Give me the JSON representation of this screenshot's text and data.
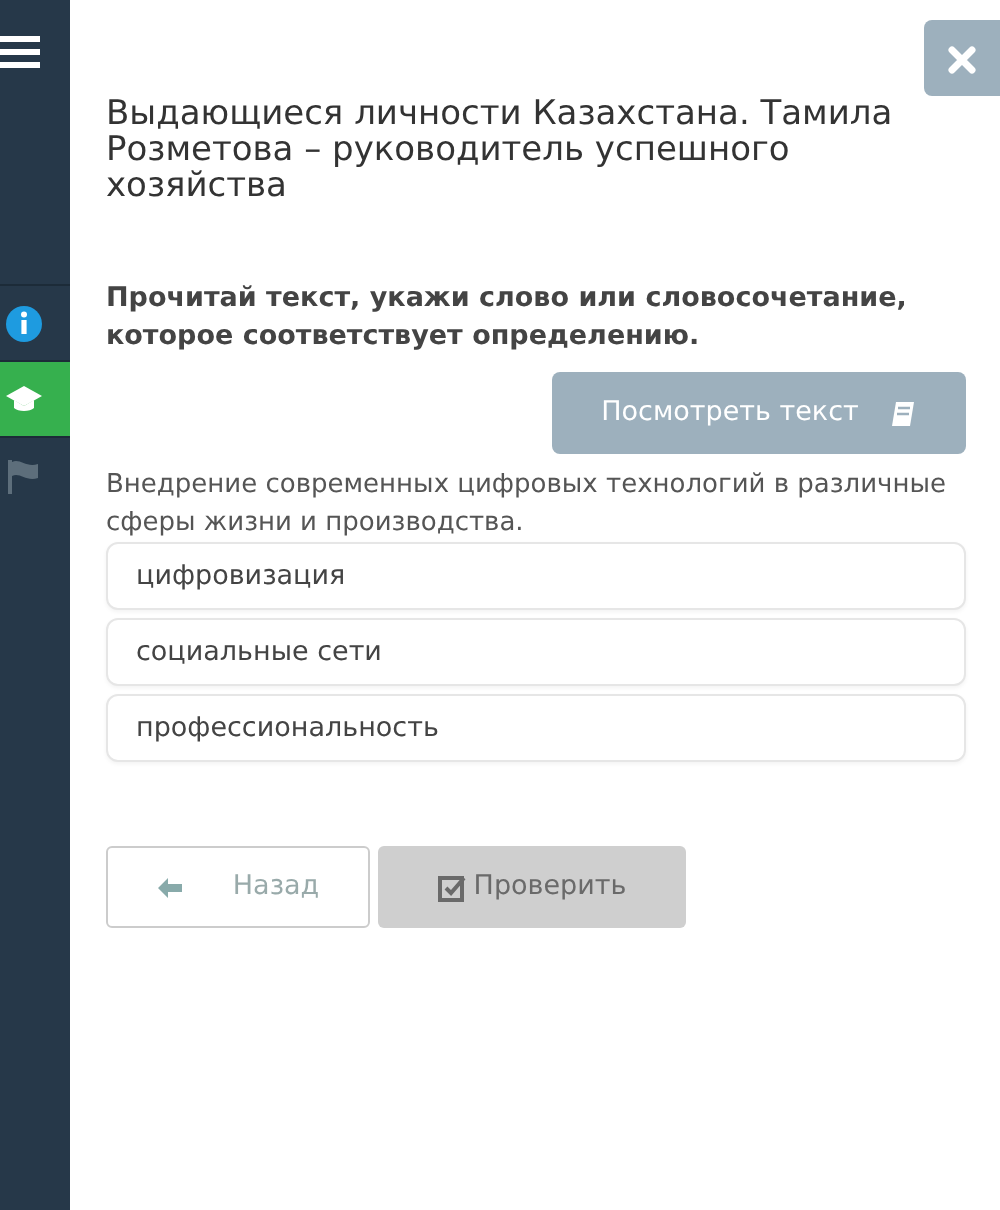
{
  "sidebar": {
    "items": [
      {
        "kind": "info",
        "selected": false
      },
      {
        "kind": "course",
        "selected": true
      },
      {
        "kind": "flag",
        "selected": false
      }
    ]
  },
  "title": "Выдающиеся личности Казахстана. Тамила Розметова – руководитель успешного хозяйства",
  "instruction": "Прочитай текст, укажи слово или словосочетание, которое соответствует определению.",
  "view_text_button": "Посмотреть текст",
  "definition": "Внедрение современных цифровых технологий в различные сферы жизни и производства.",
  "options": [
    {
      "label": "цифровизация",
      "selected": false
    },
    {
      "label": "социальные сети",
      "selected": false
    },
    {
      "label": "профессиональность",
      "selected": false
    }
  ],
  "back_button": "Назад",
  "check_button": {
    "label": "Проверить",
    "disabled": true
  }
}
